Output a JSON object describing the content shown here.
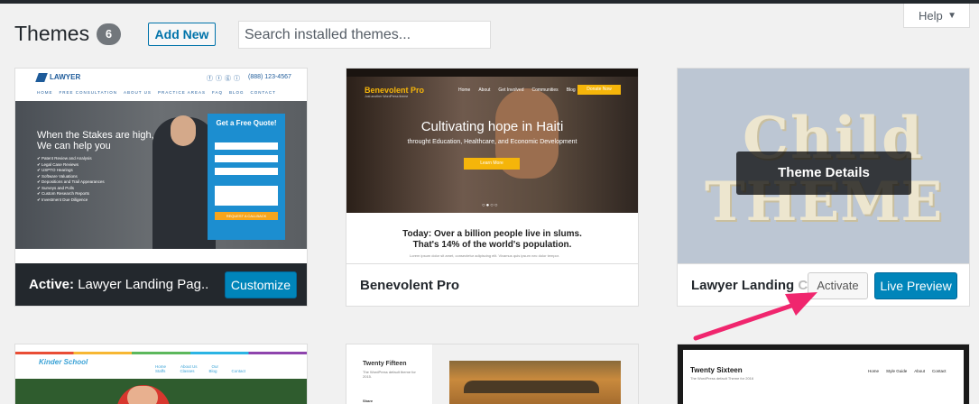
{
  "header": {
    "title": "Themes",
    "count": "6",
    "add_new": "Add New",
    "search_placeholder": "Search installed themes...",
    "help": "Help"
  },
  "themes": [
    {
      "name": "Lawyer Landing Pag...",
      "active_prefix": "Active:",
      "customize": "Customize",
      "preview": {
        "logo": "LAWYER",
        "phone": "(888) 123-4567",
        "nav": [
          "HOME",
          "FREE CONSULTATION",
          "ABOUT US",
          "PRACTICE AREAS",
          "FAQ",
          "BLOG",
          "CONTACT"
        ],
        "tagline": "When the Stakes are high, We can help you",
        "list": [
          "Patent Review and Analysis",
          "Legal Case Reviews",
          "USPTO Hearings",
          "Software Valuations",
          "Depositions and Trail Appearances",
          "Surveys and Polls",
          "Custom Research Reports",
          "Investment Due Diligence"
        ],
        "form_title": "Get a Free Quote!",
        "form_cta": "REQUEST A CALLBACK"
      }
    },
    {
      "name": "Benevolent Pro",
      "preview": {
        "logo": "Benevolent Pro",
        "logo_sub": "Just another WordPress theme",
        "nav": [
          "Home",
          "About",
          "Get Involved",
          "Communities",
          "Blog"
        ],
        "donate": "Donate Now",
        "headline": "Cultivating hope in Haiti",
        "subline": "throught Education, Healthcare, and Economic Development",
        "button": "Learn More",
        "lower_line1": "Today: Over a billion people live in slums.",
        "lower_line2": "That's 14% of the world's population.",
        "lorem": "Lorem ipsum dolor sit amet, consectetur adipiscing elit. Vivamus quis ipsum nec dolor tempor."
      }
    },
    {
      "name": "Lawyer Landing",
      "name_overflow": "C",
      "activate": "Activate",
      "live_preview": "Live Preview",
      "details": "Theme Details",
      "preview": {
        "word1": "Child",
        "word2": "THEME"
      }
    },
    {
      "name": "Kinder School",
      "preview": {
        "logo": "Kinder School",
        "nav": [
          "Home",
          "About Us",
          "Our Staffs",
          "Classes",
          "Blog",
          "Contact"
        ]
      }
    },
    {
      "name": "Twenty Fifteen",
      "preview": {
        "title": "Twenty Fifteen",
        "sub": "The WordPress default theme for 2015.",
        "sub2": "Share"
      }
    },
    {
      "name": "Twenty Sixteen",
      "preview": {
        "title": "Twenty Sixteen",
        "sub": "The WordPress default Theme for 2016",
        "nav": [
          "Home",
          "Style Guide",
          "About",
          "Contact"
        ]
      }
    }
  ],
  "colors": {
    "primary": "#0085ba",
    "arrow": "#f0266e",
    "admin_bar": "#23282d"
  }
}
